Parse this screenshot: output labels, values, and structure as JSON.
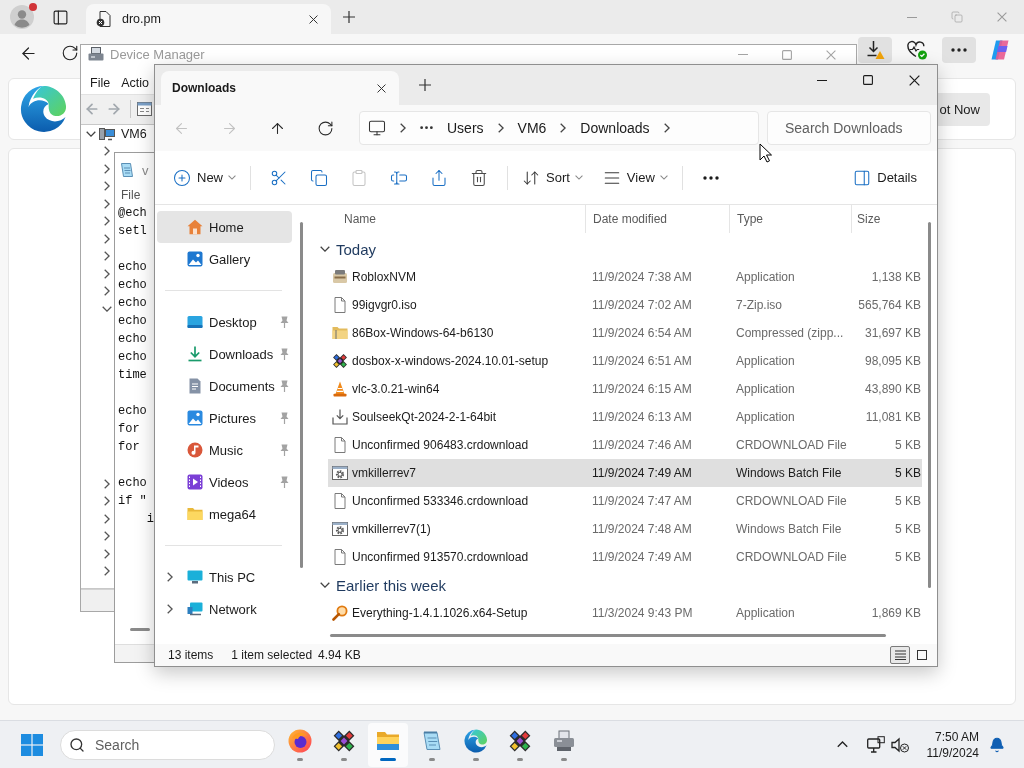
{
  "browser": {
    "tab": {
      "title": "dro.pm"
    },
    "toolbar": [
      {
        "kind": "downloads",
        "highlighted": true
      },
      {
        "kind": "essentials",
        "highlighted": false
      },
      {
        "kind": "menu",
        "highlighted": true
      },
      {
        "kind": "copilot",
        "highlighted": false
      }
    ],
    "promo": {
      "button": "ot Now"
    }
  },
  "device_manager": {
    "title": "Device Manager",
    "menu": [
      "File",
      "Actio"
    ],
    "tree": {
      "label": "VM6",
      "expanded": true,
      "children": [
        {
          "expanded": false
        },
        {
          "expanded": false
        },
        {
          "expanded": false
        },
        {
          "expanded": false
        },
        {
          "expanded": false
        },
        {
          "expanded": false
        },
        {
          "expanded": false
        },
        {
          "expanded": false
        },
        {
          "expanded": false
        },
        {
          "expanded": true
        },
        {
          "expanded": false
        },
        {
          "expanded": false
        },
        {
          "expanded": false
        },
        {
          "expanded": false
        },
        {
          "expanded": false
        },
        {
          "expanded": false
        }
      ]
    }
  },
  "notepad": {
    "title": "v",
    "menu": [
      "File"
    ],
    "paragraphs": [
      [
        "@ech",
        "setl"
      ],
      [
        "echo",
        "echo",
        "echo",
        "echo",
        "echo",
        "echo",
        "time"
      ],
      [
        "echo",
        "for",
        "for"
      ],
      [
        "echo",
        "if \"",
        "    i"
      ]
    ]
  },
  "explorer": {
    "tab": {
      "title": "Downloads"
    },
    "nav": [
      {
        "kind": "back",
        "disabled": true
      },
      {
        "kind": "forward",
        "disabled": true
      },
      {
        "kind": "up",
        "disabled": false
      },
      {
        "kind": "refresh",
        "disabled": false
      }
    ],
    "breadcrumb": [
      "Users",
      "VM6",
      "Downloads"
    ],
    "search": {
      "placeholder": "Search Downloads"
    },
    "commands": [
      {
        "kind": "new",
        "label": "New",
        "dropdown": true,
        "disabled": false
      },
      {
        "kind": "cut",
        "dropdown": false,
        "disabled": false
      },
      {
        "kind": "copy",
        "dropdown": false,
        "disabled": false
      },
      {
        "kind": "paste",
        "dropdown": false,
        "disabled": true
      },
      {
        "kind": "rename",
        "dropdown": false,
        "disabled": false
      },
      {
        "kind": "share",
        "dropdown": false,
        "disabled": false
      },
      {
        "kind": "delete",
        "dropdown": false,
        "disabled": false
      },
      {
        "kind": "sort",
        "label": "Sort",
        "dropdown": true,
        "disabled": false
      },
      {
        "kind": "view",
        "label": "View",
        "dropdown": true,
        "disabled": false
      },
      {
        "kind": "more",
        "dropdown": false,
        "disabled": false
      },
      {
        "kind": "details",
        "label": "Details",
        "dropdown": false,
        "disabled": false
      }
    ],
    "sidebar": {
      "groups": [
        {
          "items": [
            {
              "kind": "home",
              "label": "Home",
              "selected": true,
              "pinned": false
            },
            {
              "kind": "gallery",
              "label": "Gallery",
              "selected": false,
              "pinned": false
            }
          ]
        },
        {
          "items": [
            {
              "kind": "desktop",
              "label": "Desktop",
              "selected": false,
              "pinned": true
            },
            {
              "kind": "downloads",
              "label": "Downloads",
              "selected": false,
              "pinned": true
            },
            {
              "kind": "documents",
              "label": "Documents",
              "selected": false,
              "pinned": true
            },
            {
              "kind": "pictures",
              "label": "Pictures",
              "selected": false,
              "pinned": true
            },
            {
              "kind": "music",
              "label": "Music",
              "selected": false,
              "pinned": true
            },
            {
              "kind": "videos",
              "label": "Videos",
              "selected": false,
              "pinned": true
            },
            {
              "kind": "folder",
              "label": "mega64",
              "selected": false,
              "pinned": false
            }
          ]
        },
        {
          "items": [
            {
              "kind": "pc",
              "label": "This PC",
              "selected": false,
              "pinned": false,
              "expanded": false
            },
            {
              "kind": "network",
              "label": "Network",
              "selected": false,
              "pinned": false,
              "expanded": false
            }
          ]
        }
      ]
    },
    "columns": [
      "Name",
      "Date modified",
      "Type",
      "Size"
    ],
    "groups": [
      {
        "label": "Today",
        "expanded": true,
        "rows": [
          {
            "kind": "app",
            "name": "RobloxNVM",
            "date": "11/9/2024 7:38 AM",
            "type": "Application",
            "size": "1,138 KB",
            "selected": false
          },
          {
            "kind": "blank",
            "name": "99igvgr0.iso",
            "date": "11/9/2024 7:02 AM",
            "type": "7-Zip.iso",
            "size": "565,764 KB",
            "selected": false
          },
          {
            "kind": "archive",
            "name": "86Box-Windows-64-b6130",
            "date": "11/9/2024 6:54 AM",
            "type": "Compressed (zipp...",
            "size": "31,697 KB",
            "selected": false
          },
          {
            "kind": "dosbox",
            "name": "dosbox-x-windows-2024.10.01-setup",
            "date": "11/9/2024 6:51 AM",
            "type": "Application",
            "size": "98,095 KB",
            "selected": false
          },
          {
            "kind": "cone",
            "name": "vlc-3.0.21-win64",
            "date": "11/9/2024 6:15 AM",
            "type": "Application",
            "size": "43,890 KB",
            "selected": false
          },
          {
            "kind": "setup",
            "name": "SoulseekQt-2024-2-1-64bit",
            "date": "11/9/2024 6:13 AM",
            "type": "Application",
            "size": "11,081 KB",
            "selected": false
          },
          {
            "kind": "blank",
            "name": "Unconfirmed 906483.crdownload",
            "date": "11/9/2024 7:46 AM",
            "type": "CRDOWNLOAD File",
            "size": "5 KB",
            "selected": false
          },
          {
            "kind": "batch",
            "name": "vmkillerrev7",
            "date": "11/9/2024 7:49 AM",
            "type": "Windows Batch File",
            "size": "5 KB",
            "selected": true
          },
          {
            "kind": "blank",
            "name": "Unconfirmed 533346.crdownload",
            "date": "11/9/2024 7:47 AM",
            "type": "CRDOWNLOAD File",
            "size": "5 KB",
            "selected": false
          },
          {
            "kind": "batch",
            "name": "vmkillerrev7(1)",
            "date": "11/9/2024 7:48 AM",
            "type": "Windows Batch File",
            "size": "5 KB",
            "selected": false
          },
          {
            "kind": "blank",
            "name": "Unconfirmed 913570.crdownload",
            "date": "11/9/2024 7:49 AM",
            "type": "CRDOWNLOAD File",
            "size": "5 KB",
            "selected": false
          }
        ]
      },
      {
        "label": "Earlier this week",
        "expanded": true,
        "rows": [
          {
            "kind": "magnifier",
            "name": "Everything-1.4.1.1026.x64-Setup",
            "date": "11/3/2024 9:43 PM",
            "type": "Application",
            "size": "1,869 KB",
            "selected": false
          }
        ]
      }
    ],
    "status": {
      "count": "13 items",
      "selection": "1 item selected",
      "size": "4.94 KB"
    },
    "view_modes": [
      {
        "kind": "details",
        "selected": true
      },
      {
        "kind": "tiles",
        "selected": false
      }
    ]
  },
  "taskbar": {
    "search": {
      "placeholder": "Search"
    },
    "apps": [
      {
        "kind": "firefox",
        "active": false,
        "running": true
      },
      {
        "kind": "dosbox",
        "active": false,
        "running": true
      },
      {
        "kind": "explorer",
        "active": true,
        "running": true
      },
      {
        "kind": "notepad",
        "active": false,
        "running": true
      },
      {
        "kind": "edge",
        "active": false,
        "running": true
      },
      {
        "kind": "dosbox",
        "active": false,
        "running": true
      },
      {
        "kind": "devices",
        "active": false,
        "running": true
      }
    ],
    "clock": {
      "time": "7:50 AM",
      "date": "11/9/2024"
    }
  }
}
